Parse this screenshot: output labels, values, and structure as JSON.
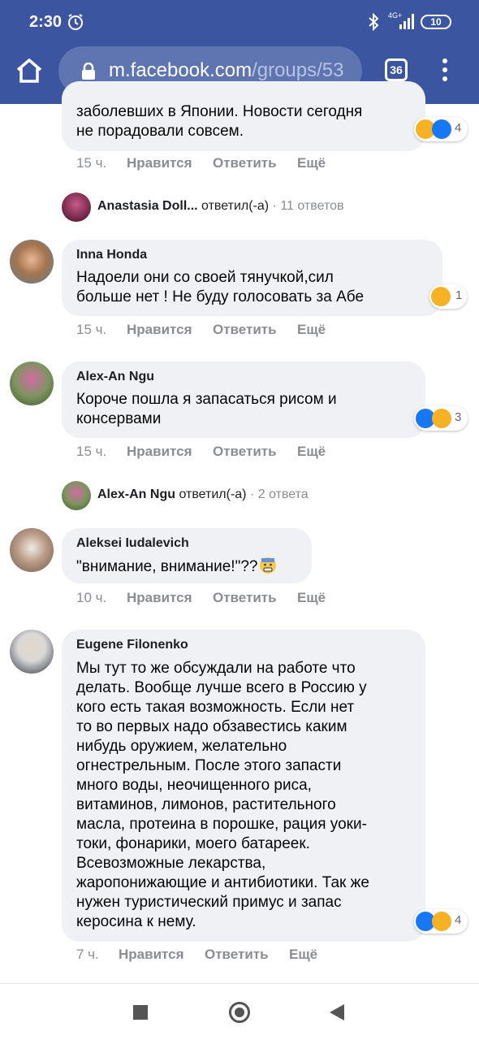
{
  "status": {
    "time": "2:30",
    "network": "4G+",
    "battery": "10"
  },
  "browser": {
    "url_main": "m.facebook.com",
    "url_path": "/groups/53",
    "tab_count": "36"
  },
  "actions": {
    "like": "Нравится",
    "reply": "Ответить",
    "more": "Ещё"
  },
  "comments": [
    {
      "text": "заболевших в Японии. Новости сегодня\nне порадовали совсем.",
      "time": "15 ч.",
      "reaction_count": "4"
    },
    {
      "author": "Inna Honda",
      "text": "Надоели они со своей тянучкой,сил\nбольше нет ! Не буду голосовать за Абе",
      "time": "15 ч.",
      "reaction_count": "1"
    },
    {
      "author": "Alex-An Ngu",
      "text": "Короче пошла я запасаться рисом и\nконсервами",
      "time": "15 ч.",
      "reaction_count": "3"
    },
    {
      "author": "Aleksei Iudalevich",
      "text": "\"внимание, внимание!\"??",
      "time": "10 ч."
    },
    {
      "author": "Eugene Filonenko",
      "text": "Мы тут то же обсуждали на работе что\nделать. Вообще лучше всего в Россию у\nкого есть такая возможность. Если нет\nто во первых надо обзавестись каким\nнибудь оружием, желательно\nогнестрельным. После этого запасти\nмного воды, неочищенного риса,\nвитаминов, лимонов, растительного\nмасла, протеина в порошке, рация уоки-\nтоки, фонарики, моего батареек.\nВсевозможные лекарства,\nжаропонижающие и антибиотики. Так же\nнужен туристический примус и запас\nкеросина к нему.",
      "time": "7 ч.",
      "reaction_count": "4"
    }
  ],
  "replies": [
    {
      "author": "Anastasia Doll...",
      "verb": "ответил(-а)",
      "count": "11 ответов"
    },
    {
      "author": "Alex-An Ngu",
      "verb": "ответил(-а)",
      "count": "2 ответа"
    }
  ]
}
